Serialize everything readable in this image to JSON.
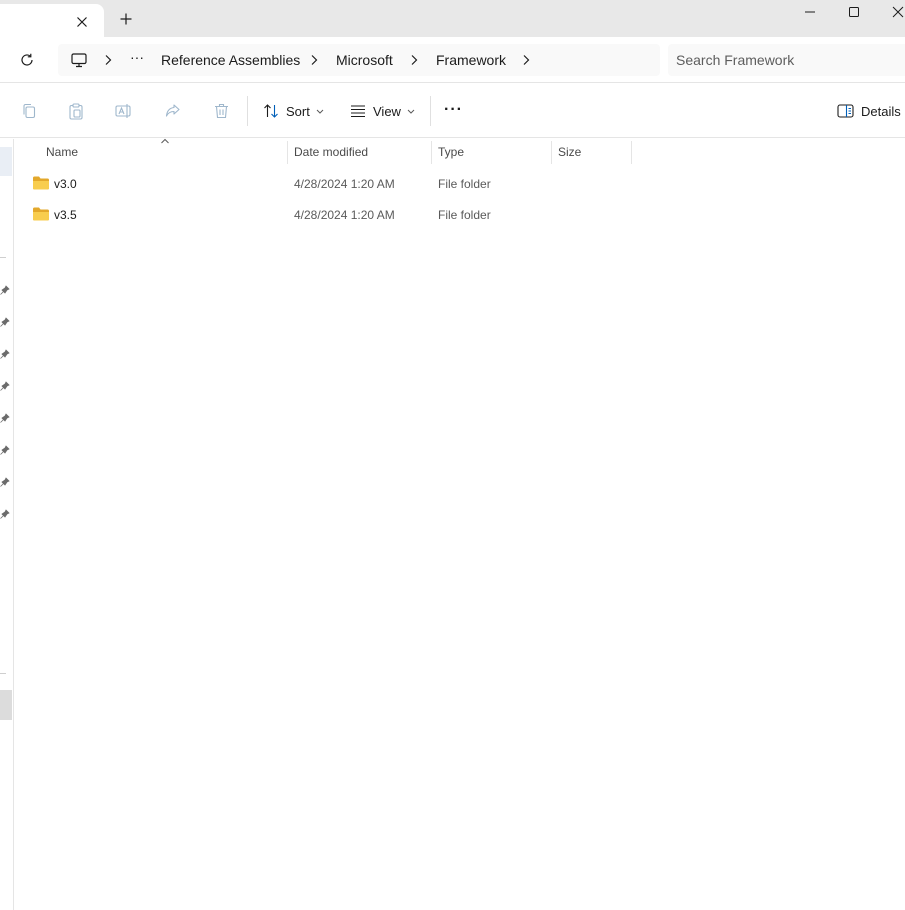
{
  "window": {
    "controls": {
      "minimize": "minimize-icon",
      "maximize": "maximize-icon",
      "close": "close-icon"
    }
  },
  "tabbar": {
    "close_icon": "close-icon",
    "new_tab_icon": "plus-icon"
  },
  "address": {
    "refresh_icon": "refresh-icon",
    "computer_icon": "computer-icon",
    "overflow_label": "···",
    "crumbs": [
      "Reference Assemblies",
      "Microsoft",
      "Framework"
    ],
    "search_placeholder": "Search Framework"
  },
  "commandbar": {
    "sort_label": "Sort",
    "view_label": "View",
    "more_label": "···",
    "details_label": "Details"
  },
  "list": {
    "columns": [
      "Name",
      "Date modified",
      "Type",
      "Size"
    ],
    "sort_indicator": "^",
    "rows": [
      {
        "name": "v3.0",
        "date": "4/28/2024 1:20 AM",
        "type": "File folder",
        "size": ""
      },
      {
        "name": "v3.5",
        "date": "4/28/2024 1:20 AM",
        "type": "File folder",
        "size": ""
      }
    ]
  },
  "colors": {
    "accent": "#005fb8",
    "folder": "#f5c445",
    "folder_dark": "#e3a82b",
    "titlebar": "#e8e8e8"
  }
}
